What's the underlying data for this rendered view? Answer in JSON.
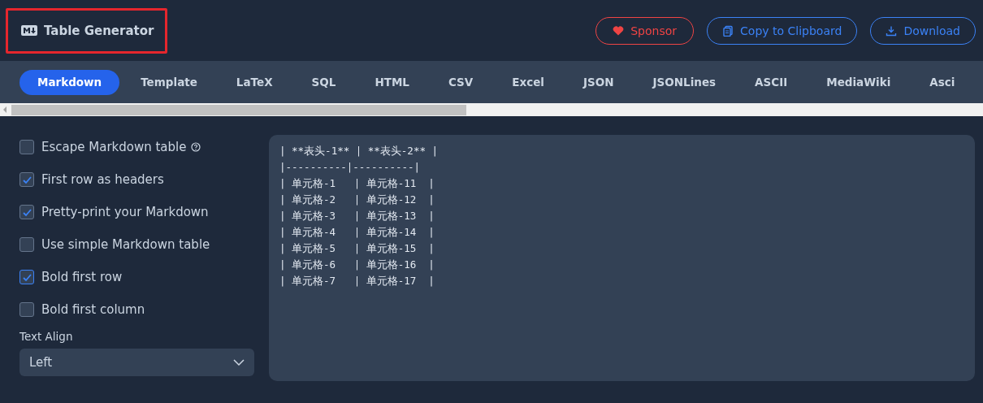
{
  "header": {
    "title": "Table Generator",
    "buttons": [
      {
        "label": "Sponsor",
        "kind": "sponsor"
      },
      {
        "label": "Copy to Clipboard",
        "kind": "copy"
      },
      {
        "label": "Download",
        "kind": "download"
      }
    ]
  },
  "tabs": [
    {
      "label": "Markdown",
      "selected": true
    },
    {
      "label": "Template",
      "selected": false
    },
    {
      "label": "LaTeX",
      "selected": false
    },
    {
      "label": "SQL",
      "selected": false
    },
    {
      "label": "HTML",
      "selected": false
    },
    {
      "label": "CSV",
      "selected": false
    },
    {
      "label": "Excel",
      "selected": false
    },
    {
      "label": "JSON",
      "selected": false
    },
    {
      "label": "JSONLines",
      "selected": false
    },
    {
      "label": "ASCII",
      "selected": false
    },
    {
      "label": "MediaWiki",
      "selected": false
    },
    {
      "label": "Asci",
      "selected": false
    }
  ],
  "options": [
    {
      "label": "Escape Markdown table",
      "checked": false,
      "help": true
    },
    {
      "label": "First row as headers",
      "checked": true
    },
    {
      "label": "Pretty-print your Markdown",
      "checked": true
    },
    {
      "label": "Use simple Markdown table",
      "checked": false
    },
    {
      "label": "Bold first row",
      "checked": true,
      "focused": true
    },
    {
      "label": "Bold first column",
      "checked": false
    }
  ],
  "text_align": {
    "label": "Text Align",
    "value": "Left"
  },
  "output": [
    "| **表头-1** | **表头-2** |",
    "|----------|----------|",
    "| 单元格-1   | 单元格-11  |",
    "| 单元格-2   | 单元格-12  |",
    "| 单元格-3   | 单元格-13  |",
    "| 单元格-4   | 单元格-14  |",
    "| 单元格-5   | 单元格-15  |",
    "| 单元格-6   | 单元格-16  |",
    "| 单元格-7   | 单元格-17  |"
  ]
}
